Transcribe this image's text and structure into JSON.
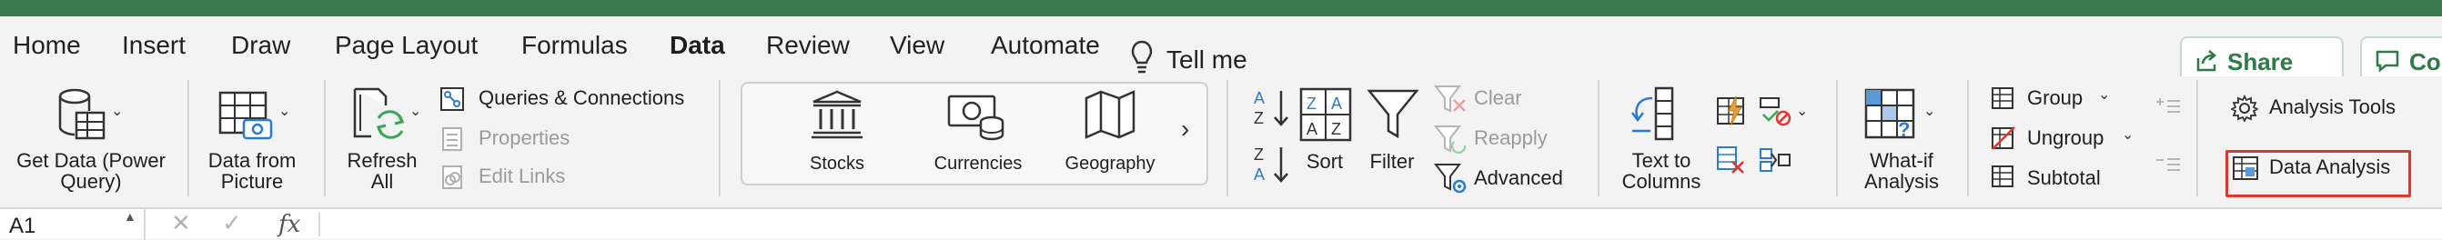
{
  "tabs": [
    "Home",
    "Insert",
    "Draw",
    "Page Layout",
    "Formulas",
    "Data",
    "Review",
    "View",
    "Automate"
  ],
  "active_tab": "Data",
  "tell_me": "Tell me",
  "share": "Share",
  "comments": "Comme",
  "ribbon": {
    "get_data": [
      "Get Data (Power",
      "Query)"
    ],
    "data_from_picture": [
      "Data from",
      "Picture"
    ],
    "refresh_all": [
      "Refresh",
      "All"
    ],
    "queries_connections": "Queries & Connections",
    "properties": "Properties",
    "edit_links": "Edit Links",
    "gallery": [
      "Stocks",
      "Currencies",
      "Geography"
    ],
    "sort": "Sort",
    "filter": "Filter",
    "clear": "Clear",
    "reapply": "Reapply",
    "advanced": "Advanced",
    "text_to_columns": [
      "Text to",
      "Columns"
    ],
    "what_if": [
      "What-if",
      "Analysis"
    ],
    "group": "Group",
    "ungroup": "Ungroup",
    "subtotal": "Subtotal",
    "analysis_tools": "Analysis Tools",
    "data_analysis": "Data Analysis"
  },
  "formula_bar": {
    "cell_ref": "A1",
    "fx": "fx"
  },
  "colors": {
    "brand_green": "#2f7a46",
    "title_green": "#3b7a4c",
    "highlight_red": "#e0362c"
  }
}
